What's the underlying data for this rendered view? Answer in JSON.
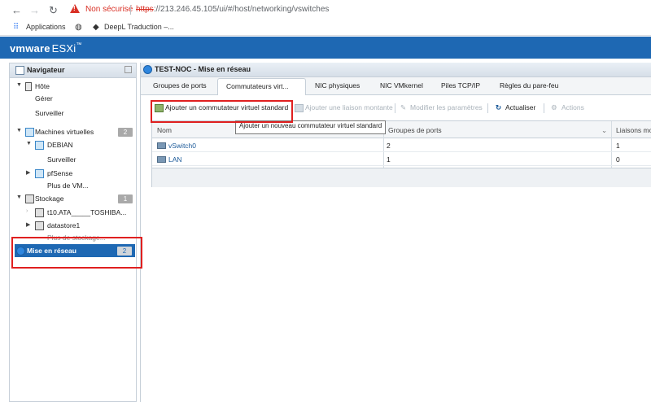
{
  "browser": {
    "security_text": "Non sécurisé",
    "url_proto": "https",
    "url_rest": "://213.246.45.105/ui/#/host/networking/vswitches",
    "bookmarks": [
      "Applications",
      "DeepL Traduction –..."
    ]
  },
  "header": {
    "brand_vm": "vm",
    "brand_ware": "ware",
    "brand_esxi": "ESXi",
    "brand_mark": "™"
  },
  "navigator": {
    "title": "Navigateur",
    "items": [
      {
        "label": "Hôte"
      },
      {
        "label": "Gérer"
      },
      {
        "label": "Surveiller"
      },
      {
        "label": "Machines virtuelles",
        "badge": "2"
      },
      {
        "label": "DEBIAN"
      },
      {
        "label": "Surveiller"
      },
      {
        "label": "pfSense"
      },
      {
        "label": "Plus de VM..."
      },
      {
        "label": "Stockage",
        "badge": "1"
      },
      {
        "label": "t10.ATA_____TOSHIBA..."
      },
      {
        "label": "datastore1"
      },
      {
        "label": "Plus de stockage..."
      },
      {
        "label": "Mise en réseau",
        "badge": "2"
      }
    ]
  },
  "main": {
    "title": "TEST-NOC - Mise en réseau",
    "tabs": [
      "Groupes de ports",
      "Commutateurs virt...",
      "NIC physiques",
      "NIC VMkernel",
      "Piles TCP/IP",
      "Règles du pare-feu"
    ],
    "toolbar": {
      "add_switch": "Ajouter un commutateur virtuel standard",
      "add_uplink": "Ajouter une liaison montante",
      "edit_settings": "Modifier les paramètres",
      "refresh": "Actualiser",
      "actions": "Actions"
    },
    "tooltip": "Ajouter un nouveau commutateur virtuel standard",
    "grid": {
      "columns": [
        "Nom",
        "Groupes de ports",
        "Liaisons mo"
      ],
      "rows": [
        {
          "name": "vSwitch0",
          "port_groups": "2",
          "uplinks": "1"
        },
        {
          "name": "LAN",
          "port_groups": "1",
          "uplinks": "0"
        }
      ]
    }
  }
}
